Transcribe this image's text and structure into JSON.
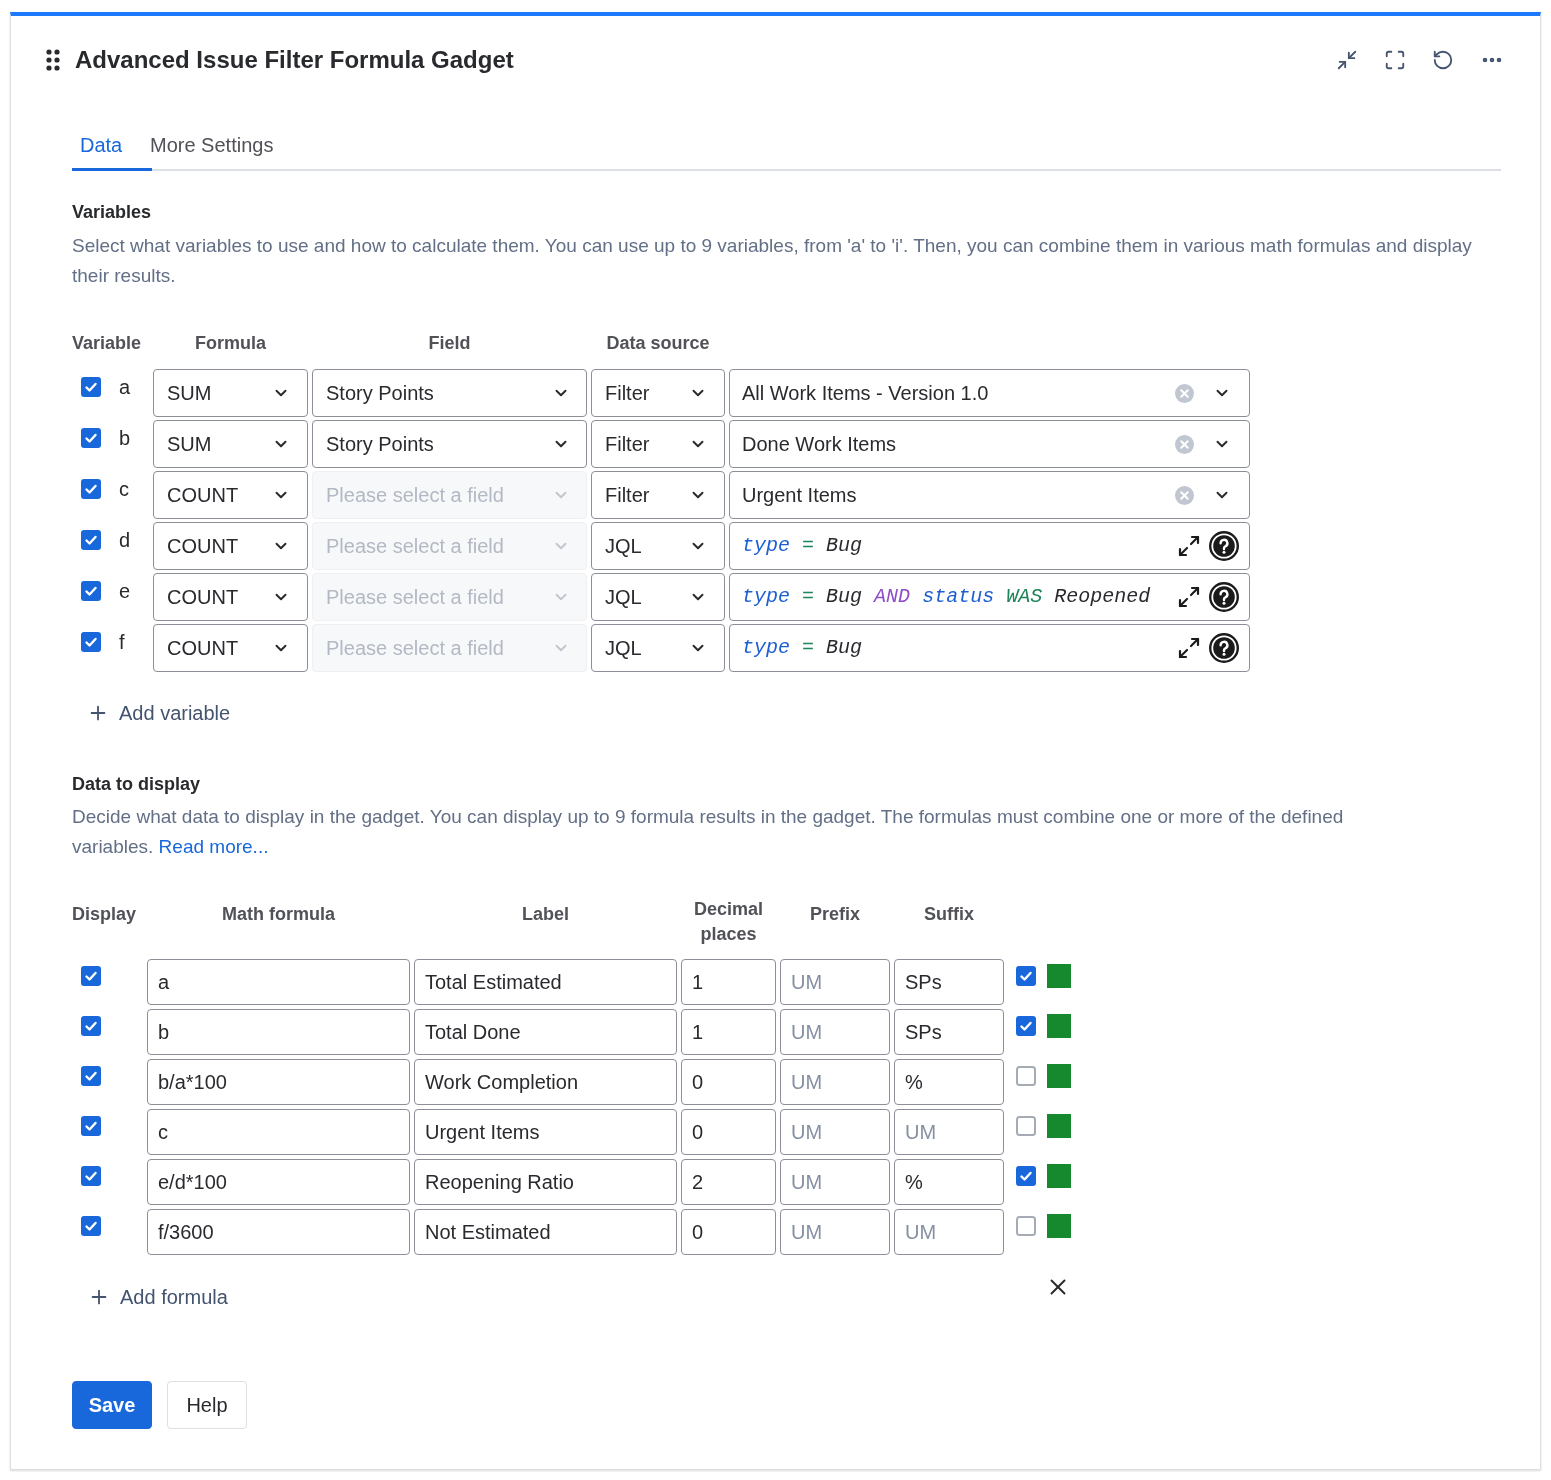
{
  "gadget": {
    "title": "Advanced Issue Filter Formula Gadget"
  },
  "tabs": [
    {
      "label": "Data",
      "selected": true
    },
    {
      "label": "More Settings",
      "selected": false
    }
  ],
  "variables": {
    "heading": "Variables",
    "description": "Select what variables to use and how to calculate them. You can use up to 9 variables, from 'a' to 'i'. Then, you can combine them in various math formulas and display their results.",
    "columns": [
      "Variable",
      "Formula",
      "Field",
      "Data source"
    ],
    "rows": [
      {
        "checked": true,
        "name": "a",
        "formula": "SUM",
        "field": {
          "value": "Story Points",
          "disabled": false
        },
        "source": "Filter",
        "query": {
          "kind": "filter",
          "value": "All Work Items - Version 1.0"
        }
      },
      {
        "checked": true,
        "name": "b",
        "formula": "SUM",
        "field": {
          "value": "Story Points",
          "disabled": false
        },
        "source": "Filter",
        "query": {
          "kind": "filter",
          "value": "Done Work Items"
        }
      },
      {
        "checked": true,
        "name": "c",
        "formula": "COUNT",
        "field": {
          "placeholder": "Please select a field",
          "disabled": true
        },
        "source": "Filter",
        "query": {
          "kind": "filter",
          "value": "Urgent Items"
        }
      },
      {
        "checked": true,
        "name": "d",
        "formula": "COUNT",
        "field": {
          "placeholder": "Please select a field",
          "disabled": true
        },
        "source": "JQL",
        "query": {
          "kind": "jql",
          "tokens": [
            {
              "kind": "field",
              "text": "type"
            },
            {
              "kind": "operator",
              "text": "="
            },
            {
              "kind": "value",
              "text": "Bug"
            }
          ]
        }
      },
      {
        "checked": true,
        "name": "e",
        "formula": "COUNT",
        "field": {
          "placeholder": "Please select a field",
          "disabled": true
        },
        "source": "JQL",
        "query": {
          "kind": "jql",
          "tokens": [
            {
              "kind": "field",
              "text": "type"
            },
            {
              "kind": "operator",
              "text": "="
            },
            {
              "kind": "value",
              "text": "Bug"
            },
            {
              "kind": "keyword",
              "text": "AND"
            },
            {
              "kind": "field",
              "text": "status"
            },
            {
              "kind": "operator",
              "text": "WAS"
            },
            {
              "kind": "value",
              "text": "Reopened"
            }
          ]
        }
      },
      {
        "checked": true,
        "name": "f",
        "formula": "COUNT",
        "field": {
          "placeholder": "Please select a field",
          "disabled": true
        },
        "source": "JQL",
        "query": {
          "kind": "jql",
          "tokens": [
            {
              "kind": "field",
              "text": "type"
            },
            {
              "kind": "operator",
              "text": "="
            },
            {
              "kind": "value",
              "text": "Bug"
            }
          ]
        }
      }
    ],
    "add_button": "Add variable"
  },
  "display": {
    "heading": "Data to display",
    "description": "Decide what data to display in the gadget. You can display up to 9 formula results in the gadget. The formulas must combine one or more of the defined variables.",
    "link": "Read more...",
    "columns": [
      "Display",
      "Math formula",
      "Label",
      "Decimal places",
      "Prefix",
      "Suffix"
    ],
    "rows": [
      {
        "display": true,
        "formula": "a",
        "label": "Total Estimated",
        "decimals": "1",
        "prefix": {
          "placeholder": "UM"
        },
        "suffix": {
          "value": "SPs"
        },
        "column_7": {
          "checked": true
        },
        "color": "#16882e"
      },
      {
        "display": true,
        "formula": "b",
        "label": "Total Done",
        "decimals": "1",
        "prefix": {
          "placeholder": "UM"
        },
        "suffix": {
          "value": "SPs"
        },
        "column_7": {
          "checked": true
        },
        "color": "#16882e"
      },
      {
        "display": true,
        "formula": "b/a*100",
        "label": "Work Completion",
        "decimals": "0",
        "prefix": {
          "placeholder": "UM"
        },
        "suffix": {
          "value": "%"
        },
        "column_7": {
          "checked": false
        },
        "color": "#16882e"
      },
      {
        "display": true,
        "formula": "c",
        "label": "Urgent Items",
        "decimals": "0",
        "prefix": {
          "placeholder": "UM"
        },
        "suffix": {
          "placeholder": "UM"
        },
        "column_7": {
          "checked": false
        },
        "color": "#16882e"
      },
      {
        "display": true,
        "formula": "e/d*100",
        "label": "Reopening Ratio",
        "decimals": "2",
        "prefix": {
          "placeholder": "UM"
        },
        "suffix": {
          "value": "%"
        },
        "column_7": {
          "checked": true
        },
        "color": "#16882e"
      },
      {
        "display": true,
        "formula": "f/3600",
        "label": "Not Estimated",
        "decimals": "0",
        "prefix": {
          "placeholder": "UM"
        },
        "suffix": {
          "placeholder": "UM"
        },
        "column_7": {
          "checked": false
        },
        "color": "#16882e"
      }
    ],
    "add_button": "Add formula"
  },
  "buttons": [
    {
      "label": "Save",
      "kind": "primary"
    },
    {
      "label": "Help",
      "kind": "secondary"
    }
  ]
}
